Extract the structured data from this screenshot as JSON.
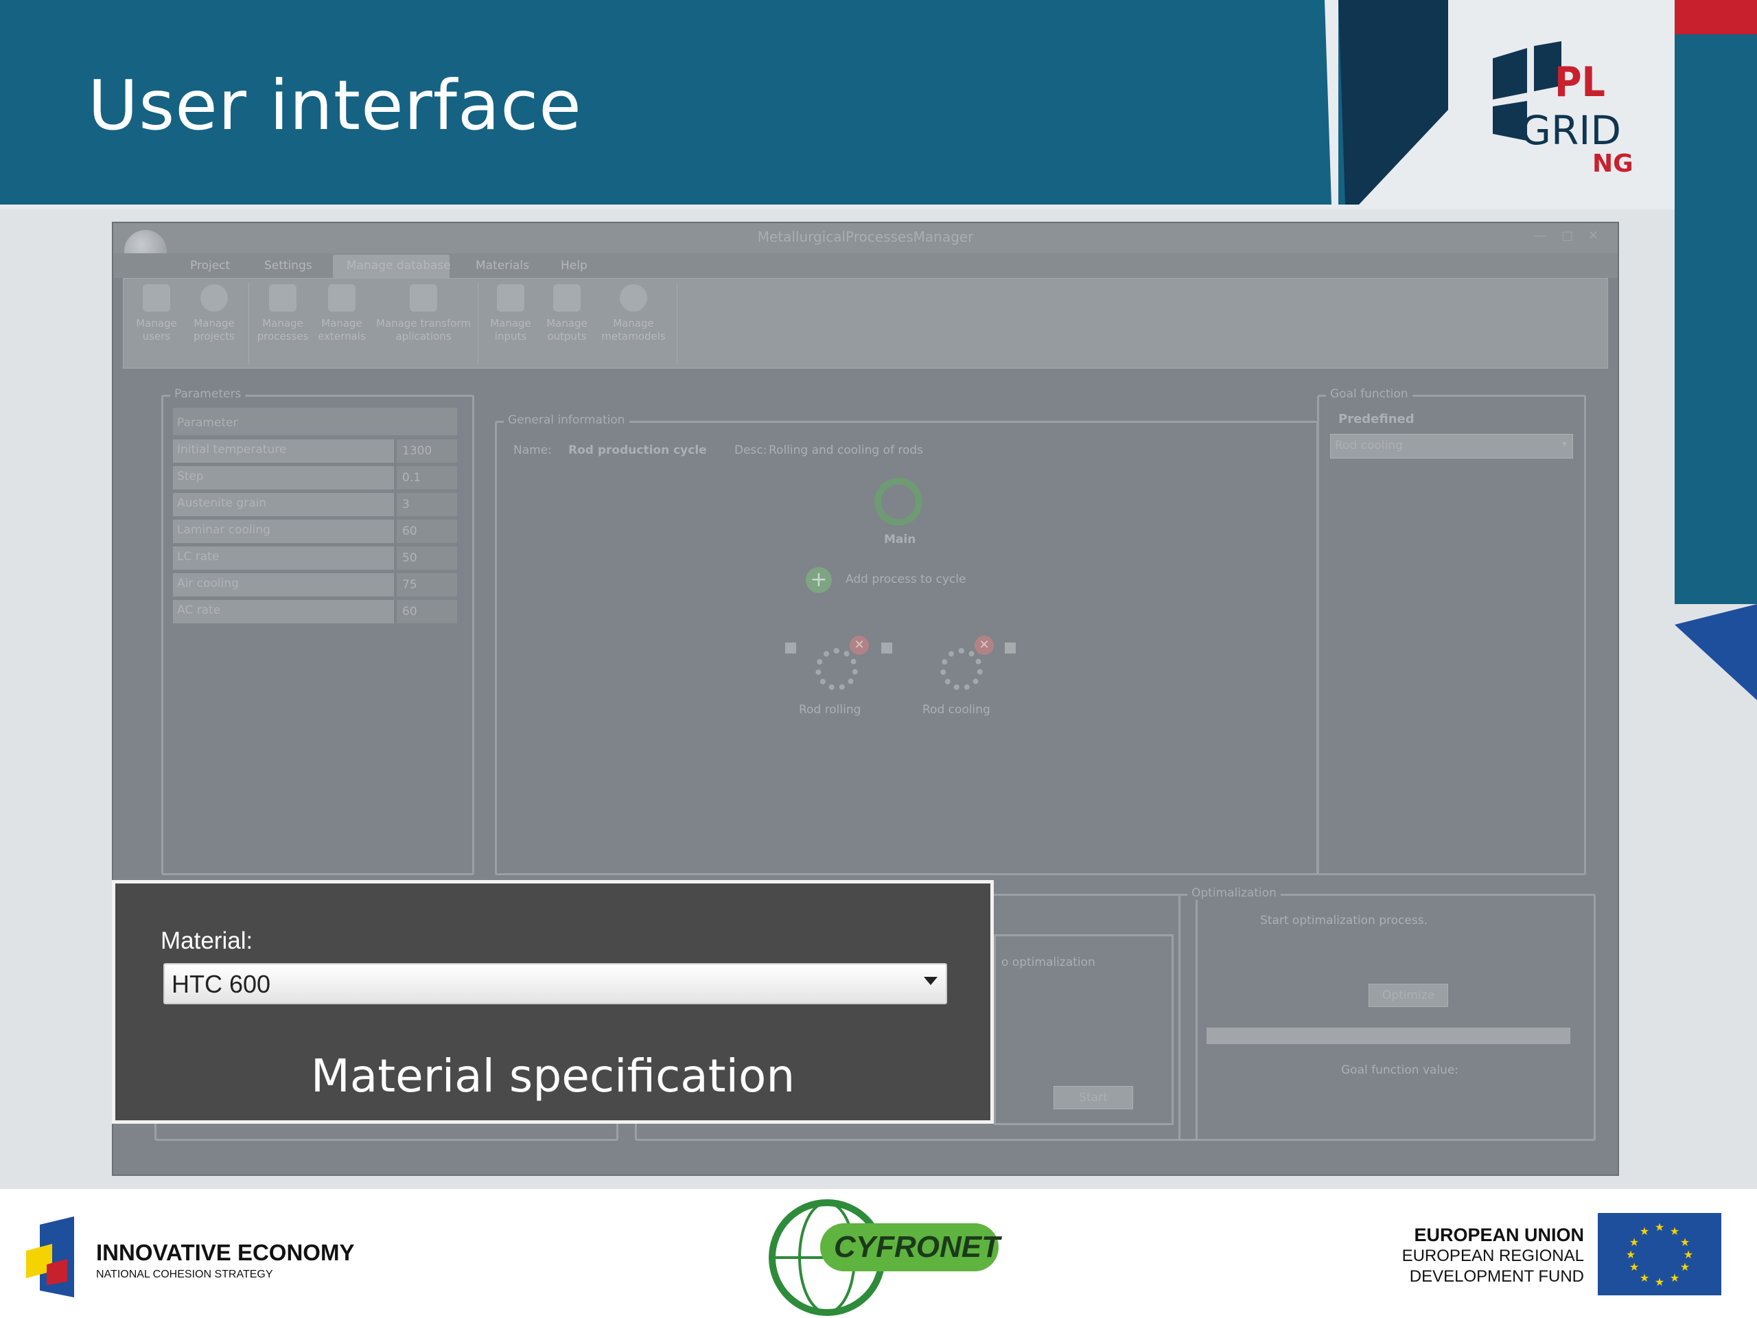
{
  "slide": {
    "title": "User interface",
    "logo_text": {
      "line1": "PL",
      "line2": "GRID",
      "line3": "NG"
    }
  },
  "window": {
    "title": "MetallurgicalProcessesManager",
    "controls": "— □ ✕",
    "menu": [
      "Project",
      "Settings",
      "Manage database",
      "Materials",
      "Help"
    ],
    "active_menu": "Manage database",
    "ribbon": [
      {
        "label": "Manage users",
        "icon": "users-icon"
      },
      {
        "label": "Manage projects",
        "icon": "projects-icon"
      },
      {
        "label": "Manage processes",
        "icon": "processes-icon"
      },
      {
        "label": "Manage externals",
        "icon": "externals-icon"
      },
      {
        "label": "Manage transform aplications",
        "icon": "transform-icon"
      },
      {
        "label": "Manage inputs",
        "icon": "inputs-icon"
      },
      {
        "label": "Manage outputs",
        "icon": "outputs-icon"
      },
      {
        "label": "Manage metamodels",
        "icon": "metamodels-icon"
      }
    ],
    "parameters": {
      "label": "Parameters",
      "header": "Parameter",
      "rows": [
        {
          "name": "Initial temperature",
          "value": "1300"
        },
        {
          "name": "Step",
          "value": "0.1"
        },
        {
          "name": "Austenite grain",
          "value": "3"
        },
        {
          "name": "Laminar cooling",
          "value": "60"
        },
        {
          "name": "LC rate",
          "value": "50"
        },
        {
          "name": "Air cooling",
          "value": "75"
        },
        {
          "name": "AC rate",
          "value": "60"
        }
      ]
    },
    "general": {
      "label": "General information",
      "name_label": "Name:",
      "name_value": "Rod production cycle",
      "desc_label": "Desc:",
      "desc_value": "Rolling and cooling of rods",
      "main_label": "Main",
      "add_label": "Add process to cycle",
      "processes": [
        "Rod rolling",
        "Rod cooling"
      ]
    },
    "goal": {
      "label": "Goal function",
      "predefined": "Predefined",
      "selected": "Rod cooling"
    },
    "optimalization": {
      "label": "Optimalization",
      "start_text": "Start optimalization process.",
      "optimize_button": "Optimize",
      "goal_value_label": "Goal function value:"
    },
    "middle": {
      "partial_text": "o optimalization",
      "start_button": "Start"
    }
  },
  "overlay": {
    "material_label": "Material:",
    "material_value": "HTC 600",
    "caption": "Material specification"
  },
  "footer": {
    "ie_title": "INNOVATIVE ECONOMY",
    "ie_subtitle": "NATIONAL COHESION STRATEGY",
    "cyfronet": "CYFRONET",
    "eu_line1": "EUROPEAN UNION",
    "eu_line2": "EUROPEAN REGIONAL",
    "eu_line3": "DEVELOPMENT FUND"
  },
  "colors": {
    "header_blue": "#156283",
    "accent_red": "#c8202d",
    "eu_blue": "#1e4f9c",
    "eu_star": "#f5d300"
  }
}
